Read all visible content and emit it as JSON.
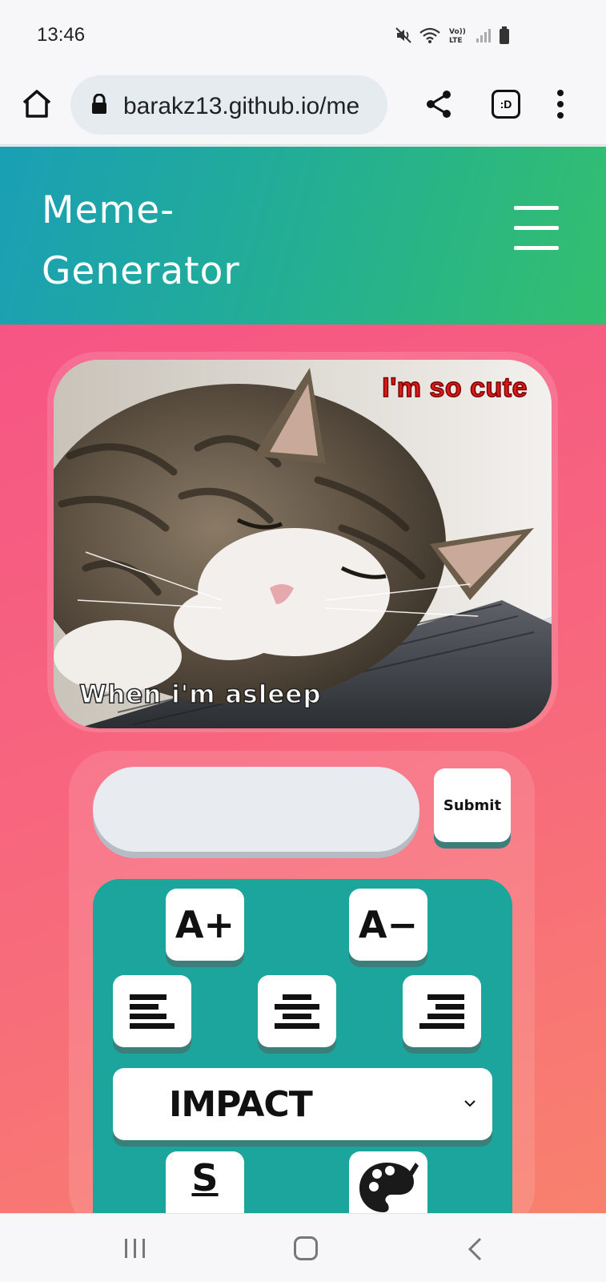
{
  "status_bar": {
    "time": "13:46",
    "icons": [
      "mute-icon",
      "wifi-icon",
      "volte-icon",
      "signal-icon",
      "battery-icon"
    ],
    "volte_label": "Vo)) LTE"
  },
  "browser": {
    "url": "barakz13.github.io/me",
    "tabs_label": ":D",
    "icons": [
      "home-icon",
      "lock-icon",
      "share-icon",
      "tabs-icon",
      "more-vert-icon"
    ]
  },
  "site": {
    "title": "Meme-Generator",
    "menu_icon": "hamburger-icon",
    "header_colors": [
      "#1a9fb5",
      "#33bf6e"
    ],
    "main_colors": [
      "#f65584",
      "#f8816d"
    ]
  },
  "meme": {
    "top_text": "I'm so cute",
    "bottom_text": "When i'm asleep",
    "top_text_color": "#d81a1a",
    "bottom_text_color": "#ffffff",
    "image_description": "sleeping tabby cat"
  },
  "controls": {
    "input_value": "",
    "submit_label": "Submit",
    "increase_font_label": "A+",
    "decrease_font_label": "A−",
    "align_icons": [
      "align-left-icon",
      "align-center-icon",
      "align-right-icon"
    ],
    "font_select_value": "IMPACT",
    "stroke_label": "S",
    "palette_icon": "palette-icon",
    "accent_color": "#1ca59c"
  },
  "nav": {
    "icons": [
      "recents-icon",
      "home-icon",
      "back-icon"
    ]
  }
}
